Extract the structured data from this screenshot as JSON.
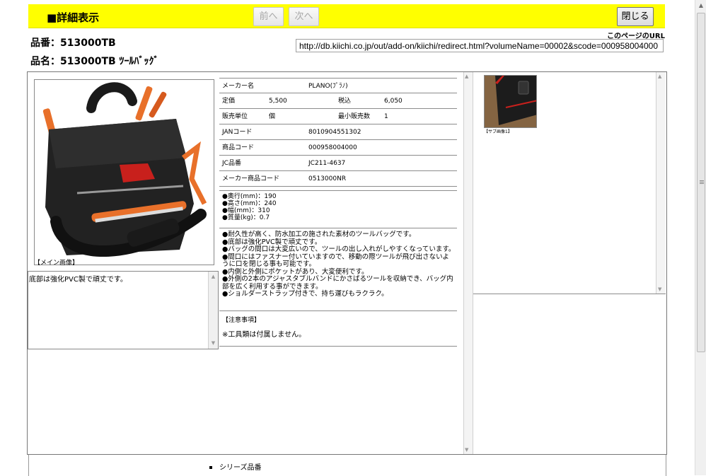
{
  "header": {
    "title": "■詳細表示",
    "prev_label": "前へ",
    "next_label": "次へ",
    "close_label": "閉じる"
  },
  "product": {
    "number_line": "品番：513000TB",
    "name_line": "品名：513000TB ﾂｰﾙﾊﾞｯｸﾞ"
  },
  "page_url": {
    "label": "このページのURL",
    "value": "http://db.kiichi.co.jp/out/add-on/kiichi/redirect.html?volumeName=00002&scode=000958004000"
  },
  "main_image": {
    "caption": "【メイン画像】"
  },
  "description_box": {
    "text": "底部は強化PVC製で頑丈です。"
  },
  "spec": {
    "rows": [
      {
        "k1": "メーカー名",
        "v1": "PLANO(ﾌﾟﾗﾉ)"
      },
      {
        "k1": "定価",
        "v1": "5,500",
        "k2": "税込",
        "v2": "6,050"
      },
      {
        "k1": "販売単位",
        "v1": "個",
        "k2": "最小販売数",
        "v2": "1"
      },
      {
        "k1": "JANコード",
        "v1": "8010904551302"
      },
      {
        "k1": "商品コード",
        "v1": "000958004000"
      },
      {
        "k1": "JC品番",
        "v1": "JC211-4637"
      },
      {
        "k1": "メーカー商品コード",
        "v1": "0513000NR"
      }
    ]
  },
  "dimensions": [
    "●奥行(mm)：190",
    "●高さ(mm)：240",
    "●幅(mm)：310",
    "●質量(kg)：0.7"
  ],
  "features": [
    "●耐久性が高く、防水加工の施された素材のツールバッグです。",
    "●底部は強化PVC製で頑丈です。",
    "●バッグの間口は大変広いので、ツールの出し入れがしやすくなっています。",
    "●間口にはファスナー付いていますので、移動の際ツールが飛び出さないように口を閉じる事も可能です。",
    "●内側と外側にポケットがあり、大変便利です。",
    "●外側の2本のアジャスタブルバンドにかさばるツールを収納でき、バッグ内部を広く利用する事ができます。",
    "●ショルダーストラップ付きで、持ち運びもラクラク。"
  ],
  "notes": {
    "title": "【注意事項】",
    "text": "※工具類は付属しません。"
  },
  "sub_image": {
    "caption": "【サブ画像1】"
  },
  "series": {
    "label": "シリーズ品番"
  }
}
